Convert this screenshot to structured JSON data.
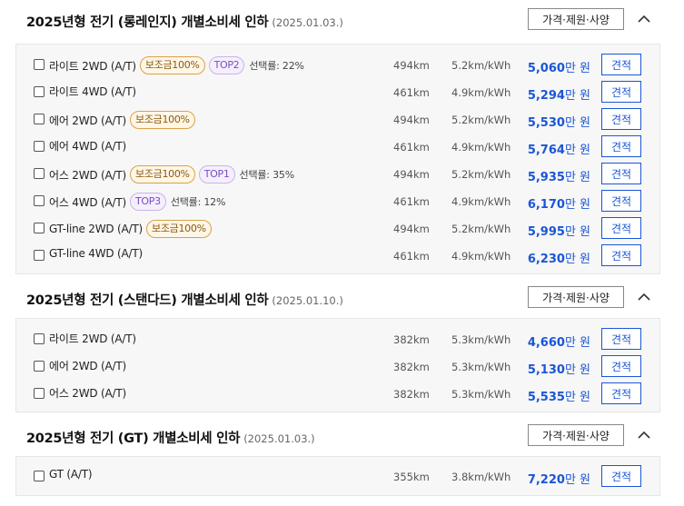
{
  "sections": [
    {
      "title": "2025년형 전기 (롱레인지) 개별소비세 인하",
      "date": "(2025.01.03.)",
      "spec_label": "가격·제원·사양",
      "rows": [
        {
          "trim": "라이트 2WD (A/T)",
          "subsidy": "보조금100%",
          "top": "TOP2",
          "rate": "선택률: 22%",
          "range": "494km",
          "efficiency": "5.2km/kWh",
          "price_num": "5,060",
          "price_unit": "만 원",
          "quote": "견적"
        },
        {
          "trim": "라이트 4WD (A/T)",
          "range": "461km",
          "efficiency": "4.9km/kWh",
          "price_num": "5,294",
          "price_unit": "만 원",
          "quote": "견적"
        },
        {
          "trim": "에어 2WD (A/T)",
          "subsidy": "보조금100%",
          "range": "494km",
          "efficiency": "5.2km/kWh",
          "price_num": "5,530",
          "price_unit": "만 원",
          "quote": "견적"
        },
        {
          "trim": "에어 4WD (A/T)",
          "range": "461km",
          "efficiency": "4.9km/kWh",
          "price_num": "5,764",
          "price_unit": "만 원",
          "quote": "견적"
        },
        {
          "trim": "어스 2WD (A/T)",
          "subsidy": "보조금100%",
          "top": "TOP1",
          "rate": "선택률: 35%",
          "range": "494km",
          "efficiency": "5.2km/kWh",
          "price_num": "5,935",
          "price_unit": "만 원",
          "quote": "견적"
        },
        {
          "trim": "어스 4WD (A/T)",
          "top": "TOP3",
          "rate": "선택률: 12%",
          "range": "461km",
          "efficiency": "4.9km/kWh",
          "price_num": "6,170",
          "price_unit": "만 원",
          "quote": "견적"
        },
        {
          "trim": "GT-line 2WD (A/T)",
          "subsidy": "보조금100%",
          "range": "494km",
          "efficiency": "5.2km/kWh",
          "price_num": "5,995",
          "price_unit": "만 원",
          "quote": "견적"
        },
        {
          "trim": "GT-line 4WD (A/T)",
          "range": "461km",
          "efficiency": "4.9km/kWh",
          "price_num": "6,230",
          "price_unit": "만 원",
          "quote": "견적"
        }
      ]
    },
    {
      "title": "2025년형 전기 (스탠다드) 개별소비세 인하",
      "date": "(2025.01.10.)",
      "spec_label": "가격·제원·사양",
      "rows": [
        {
          "trim": "라이트 2WD (A/T)",
          "range": "382km",
          "efficiency": "5.3km/kWh",
          "price_num": "4,660",
          "price_unit": "만 원",
          "quote": "견적"
        },
        {
          "trim": "에어 2WD (A/T)",
          "range": "382km",
          "efficiency": "5.3km/kWh",
          "price_num": "5,130",
          "price_unit": "만 원",
          "quote": "견적"
        },
        {
          "trim": "어스 2WD (A/T)",
          "range": "382km",
          "efficiency": "5.3km/kWh",
          "price_num": "5,535",
          "price_unit": "만 원",
          "quote": "견적"
        }
      ]
    },
    {
      "title": "2025년형 전기 (GT) 개별소비세 인하",
      "date": "(2025.01.03.)",
      "spec_label": "가격·제원·사양",
      "rows": [
        {
          "trim": "GT (A/T)",
          "range": "355km",
          "efficiency": "3.8km/kWh",
          "price_num": "7,220",
          "price_unit": "만 원",
          "quote": "견적"
        }
      ]
    }
  ],
  "colors": {
    "accent": "#1a56d6",
    "subsidy_border": "#d8a24a",
    "top_border": "#c9b3e8"
  },
  "icons": {
    "collapse": "chevron-up-icon"
  }
}
